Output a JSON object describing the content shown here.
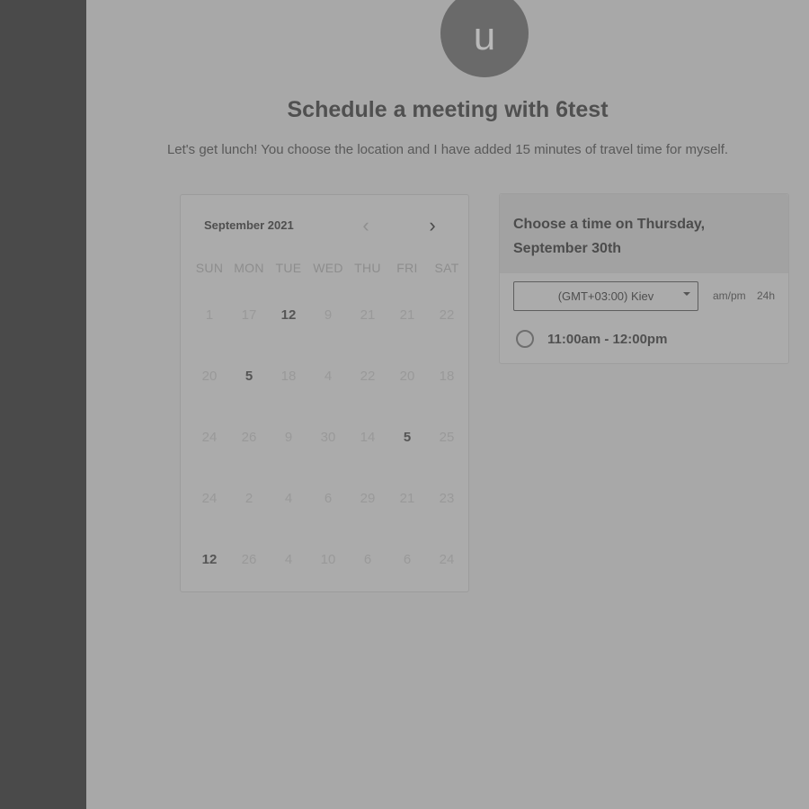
{
  "avatar": {
    "initial": "u"
  },
  "header": {
    "title": "Schedule a meeting with 6test",
    "subtitle": "Let's get lunch! You choose the location and I have added 15 minutes of travel time for myself."
  },
  "calendar": {
    "month_label": "September 2021",
    "prev_icon": "‹",
    "next_icon": "›",
    "weekdays": [
      "SUN",
      "MON",
      "TUE",
      "WED",
      "THU",
      "FRI",
      "SAT"
    ],
    "rows": [
      [
        {
          "d": "1",
          "a": false
        },
        {
          "d": "17",
          "a": false
        },
        {
          "d": "12",
          "a": true
        },
        {
          "d": "9",
          "a": false
        },
        {
          "d": "21",
          "a": false
        },
        {
          "d": "21",
          "a": false
        },
        {
          "d": "22",
          "a": false
        }
      ],
      [
        {
          "d": "20",
          "a": false
        },
        {
          "d": "5",
          "a": true
        },
        {
          "d": "18",
          "a": false
        },
        {
          "d": "4",
          "a": false
        },
        {
          "d": "22",
          "a": false
        },
        {
          "d": "20",
          "a": false
        },
        {
          "d": "18",
          "a": false
        }
      ],
      [
        {
          "d": "24",
          "a": false
        },
        {
          "d": "26",
          "a": false
        },
        {
          "d": "9",
          "a": false
        },
        {
          "d": "30",
          "a": false
        },
        {
          "d": "14",
          "a": false
        },
        {
          "d": "5",
          "a": true
        },
        {
          "d": "25",
          "a": false
        }
      ],
      [
        {
          "d": "24",
          "a": false
        },
        {
          "d": "2",
          "a": false
        },
        {
          "d": "4",
          "a": false
        },
        {
          "d": "6",
          "a": false
        },
        {
          "d": "29",
          "a": false
        },
        {
          "d": "21",
          "a": false
        },
        {
          "d": "23",
          "a": false
        }
      ],
      [
        {
          "d": "12",
          "a": true
        },
        {
          "d": "26",
          "a": false
        },
        {
          "d": "4",
          "a": false
        },
        {
          "d": "10",
          "a": false
        },
        {
          "d": "6",
          "a": false
        },
        {
          "d": "6",
          "a": false
        },
        {
          "d": "24",
          "a": false
        }
      ]
    ]
  },
  "time_picker": {
    "title": "Choose a time on Thursday, September 30th",
    "timezone": "(GMT+03:00) Kiev",
    "format_ampm": "am/pm",
    "format_24h": "24h",
    "slots": [
      "11:00am - 12:00pm"
    ]
  },
  "colors": {
    "sidebar": "#4a4a4a",
    "background": "#a8a8a8",
    "avatar": "#6a6a6a"
  }
}
